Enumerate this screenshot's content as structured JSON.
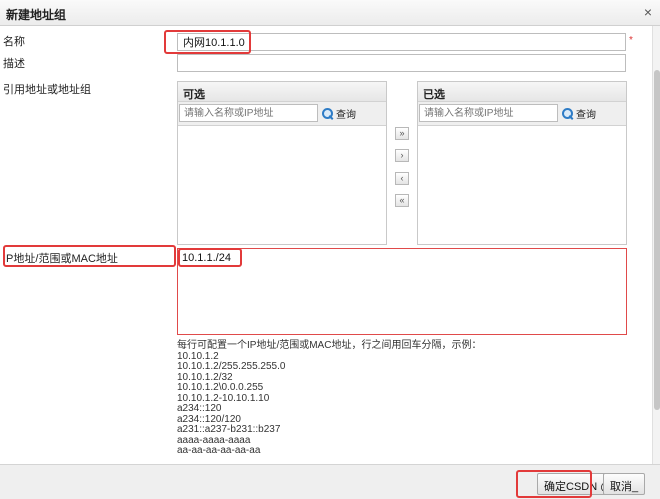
{
  "dialog": {
    "title": "新建地址组",
    "close_icon": "×"
  },
  "form": {
    "name_label": "名称",
    "name_value": "内网10.1.1.0",
    "desc_label": "描述",
    "desc_value": "",
    "ref_label": "引用地址或地址组",
    "ip_label": "IP地址/范围或MAC地址",
    "ip_value": "10.1.1./24"
  },
  "available": {
    "title": "可选",
    "search_placeholder": "请输入名称或IP地址",
    "search_label": "查询"
  },
  "selected": {
    "title": "已选",
    "search_placeholder": "请输入名称或IP地址",
    "search_label": "查询"
  },
  "move_buttons": {
    "add_all": "»",
    "add": "›",
    "remove": "‹",
    "remove_all": "«"
  },
  "hint": {
    "intro": "每行可配置一个IP地址/范围或MAC地址，行之间用回车分隔，示例：",
    "examples": [
      "10.10.1.2",
      "10.10.1.2/255.255.255.0",
      "10.10.1.2/32",
      "10.10.1.2\\0.0.0.255",
      "10.10.1.2-10.10.1.10",
      "a234::120",
      "a234::120/120",
      "a231::a237-b231::b237",
      "aaaa-aaaa-aaaa",
      "aa-aa-aa-aa-aa-aa"
    ]
  },
  "footer": {
    "ok_label": "确定CSDN @",
    "cancel_label": "取消_"
  },
  "colors": {
    "highlight": "#e23a3a",
    "accent": "#2e7cc6"
  }
}
